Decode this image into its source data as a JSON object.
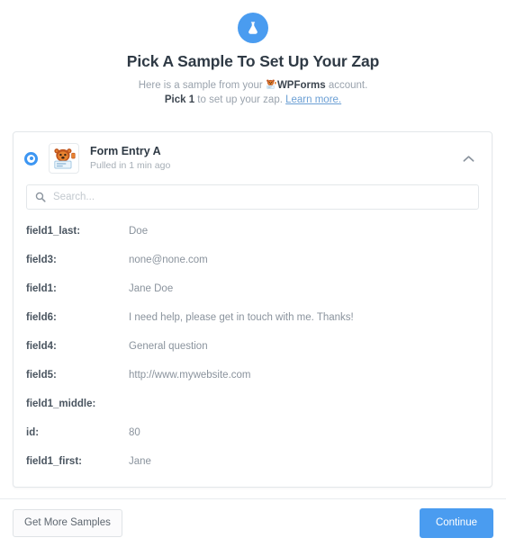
{
  "header": {
    "icon": "flask-icon",
    "title": "Pick A Sample To Set Up Your Zap",
    "subtitle_line1_prefix": "Here is a sample from your",
    "subtitle_app_icon": "wpforms-icon",
    "subtitle_app_name": "WPForms",
    "subtitle_line1_suffix": "account.",
    "subtitle_line2_bold": "Pick 1",
    "subtitle_line2_rest": "to set up your zap.",
    "learn_more_label": "Learn more."
  },
  "sample_card": {
    "radio_selected": true,
    "app_icon": "wpforms-icon",
    "entry_title": "Form Entry A",
    "entry_subtitle": "Pulled in 1 min ago",
    "collapse_icon": "chevron-up-icon",
    "search": {
      "icon": "search-icon",
      "value": "",
      "placeholder": "Search..."
    },
    "fields": [
      {
        "key": "field1_last:",
        "value": "Doe"
      },
      {
        "key": "field3:",
        "value": "none@none.com"
      },
      {
        "key": "field1:",
        "value": "Jane Doe"
      },
      {
        "key": "field6:",
        "value": "I need help, please get in touch with me. Thanks!"
      },
      {
        "key": "field4:",
        "value": "General question"
      },
      {
        "key": "field5:",
        "value": "http://www.mywebsite.com"
      },
      {
        "key": "field1_middle:",
        "value": ""
      },
      {
        "key": "id:",
        "value": "80"
      },
      {
        "key": "field1_first:",
        "value": "Jane"
      }
    ]
  },
  "footer": {
    "get_more_samples_label": "Get More Samples",
    "continue_label": "Continue"
  },
  "colors": {
    "accent_blue": "#4a9cf0",
    "radio_blue": "#3d96f2",
    "link_blue": "#6b9fd4",
    "text_dark": "#2f3a45",
    "text_muted": "#9aa3ad",
    "card_border": "#e3e7ea"
  }
}
